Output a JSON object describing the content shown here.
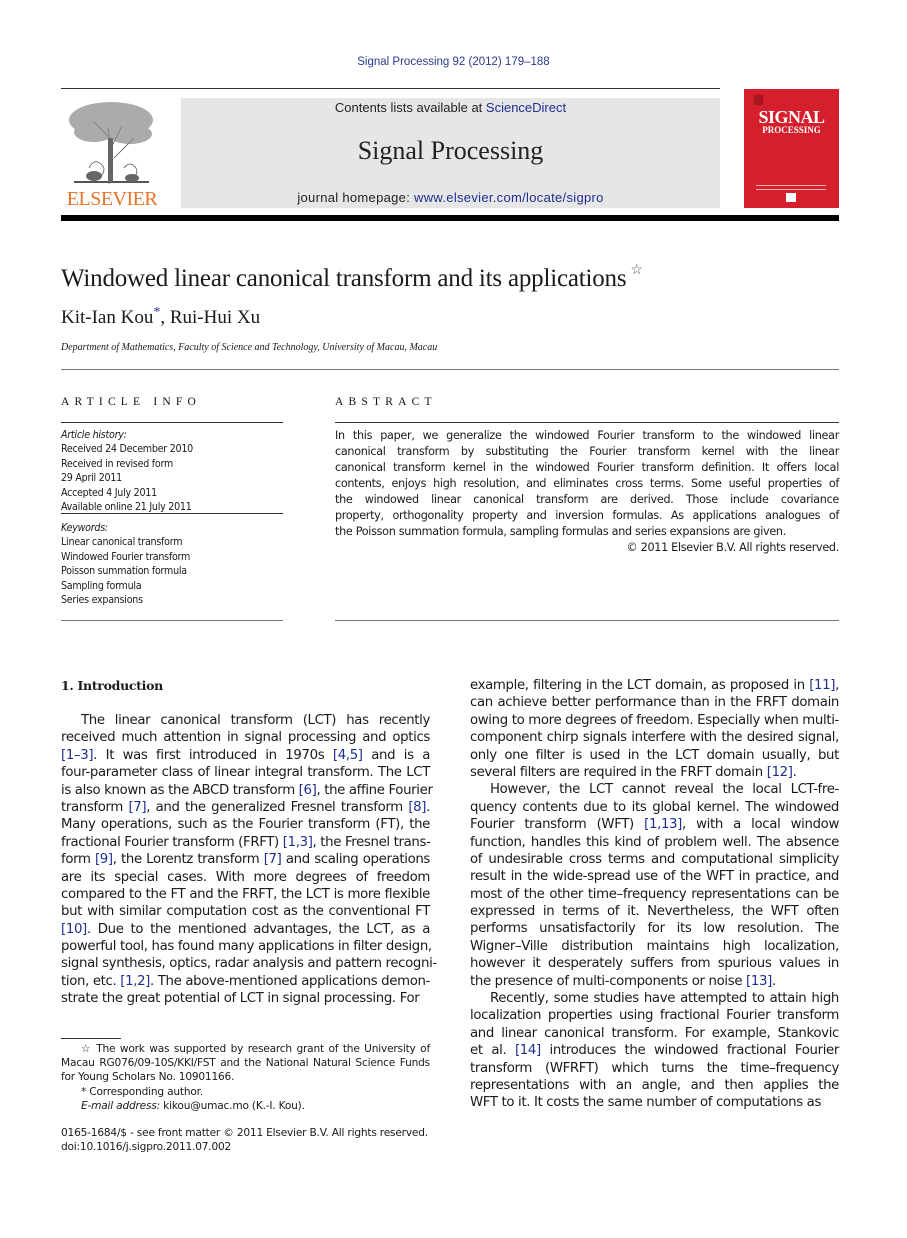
{
  "header": {
    "journal_ref": "Signal Processing 92 (2012) 179–188",
    "contents_prefix": "Contents lists available at ",
    "contents_link": "ScienceDirect",
    "journal_name": "Signal Processing",
    "homepage_prefix": "journal homepage: ",
    "homepage_link": "www.elsevier.com/locate/sigpro",
    "publisher_logo_text": "ELSEVIER",
    "cover_title_line1": "SIGNAL",
    "cover_title_line2": "PROCESSING",
    "colors": {
      "elsevier_orange": "#e8742a",
      "cover_red": "#d51f2c",
      "link_blue": "#1f2f8f",
      "header_gray": "#e6e6e6"
    }
  },
  "article": {
    "title": "Windowed linear canonical transform and its applications",
    "title_mark": "☆",
    "authors_part1": "Kit-Ian Kou",
    "author_mark": "*",
    "authors_part2": ", Rui-Hui Xu",
    "affiliation": "Department of Mathematics, Faculty of Science and Technology, University of Macau, Macau"
  },
  "article_info": {
    "heading": "ARTICLE INFO",
    "history_label": "Article history:",
    "history": [
      "Received 24 December 2010",
      "Received in revised form",
      "29 April 2011",
      "Accepted 4 July 2011",
      "Available online 21 July 2011"
    ],
    "keywords_label": "Keywords:",
    "keywords": [
      "Linear canonical transform",
      "Windowed Fourier transform",
      "Poisson summation formula",
      "Sampling formula",
      "Series expansions"
    ]
  },
  "abstract": {
    "heading": "ABSTRACT",
    "lines": [
      "In this paper, we generalize the windowed Fourier transform to the windowed linear",
      "canonical transform by substituting the Fourier transform kernel with the linear",
      "canonical transform kernel in the windowed Fourier transform definition. It offers local",
      "contents, enjoys high resolution, and eliminates cross terms. Some useful properties of",
      "the windowed linear canonical transform are derived. Those include covariance",
      "property, orthogonality property and inversion formulas. As applications analogues of",
      "the Poisson summation formula, sampling formulas and series expansions are given."
    ],
    "copyright": "© 2011 Elsevier B.V. All rights reserved."
  },
  "introduction": {
    "heading": "1.  Introduction",
    "col1_lines": [
      [
        {
          "t": "The linear canonical transform (LCT) has recently"
        }
      ],
      [
        {
          "t": "received much attention in signal processing and optics"
        }
      ],
      [
        {
          "t": "[1–3]",
          "ref": true
        },
        {
          "t": ". It was first introduced in 1970s "
        },
        {
          "t": "[4,5]",
          "ref": true
        },
        {
          "t": " and is a"
        }
      ],
      [
        {
          "t": "four-parameter class of linear integral transform. The LCT"
        }
      ],
      [
        {
          "t": "is also known as the ABCD transform "
        },
        {
          "t": "[6]",
          "ref": true
        },
        {
          "t": ", the affine Fourier"
        }
      ],
      [
        {
          "t": "transform "
        },
        {
          "t": "[7]",
          "ref": true
        },
        {
          "t": ", and the generalized Fresnel transform "
        },
        {
          "t": "[8]",
          "ref": true
        },
        {
          "t": "."
        }
      ],
      [
        {
          "t": "Many operations, such as the Fourier transform (FT), the"
        }
      ],
      [
        {
          "t": "fractional Fourier transform (FRFT) "
        },
        {
          "t": "[1,3]",
          "ref": true
        },
        {
          "t": ", the Fresnel trans-"
        }
      ],
      [
        {
          "t": "form "
        },
        {
          "t": "[9]",
          "ref": true
        },
        {
          "t": ", the Lorentz transform "
        },
        {
          "t": "[7]",
          "ref": true
        },
        {
          "t": " and scaling operations"
        }
      ],
      [
        {
          "t": "are its special cases. With more degrees of freedom"
        }
      ],
      [
        {
          "t": "compared to the FT and the FRFT, the LCT is more flexible"
        }
      ],
      [
        {
          "t": "but with similar computation cost as the conventional FT"
        }
      ],
      [
        {
          "t": "[10]",
          "ref": true
        },
        {
          "t": ". Due to the mentioned advantages, the LCT, as a"
        }
      ],
      [
        {
          "t": "powerful tool, has found many applications in filter design,"
        }
      ],
      [
        {
          "t": "signal synthesis, optics, radar analysis and pattern recogni-"
        }
      ],
      [
        {
          "t": "tion, etc. "
        },
        {
          "t": "[1,2]",
          "ref": true
        },
        {
          "t": ". The above-mentioned applications demon-"
        }
      ],
      [
        {
          "t": "strate the great potential of LCT in signal processing. For"
        }
      ]
    ],
    "col2_lines": [
      [
        {
          "t": "example, filtering in the LCT domain, as proposed in "
        },
        {
          "t": "[11]",
          "ref": true
        },
        {
          "t": ","
        }
      ],
      [
        {
          "t": "can achieve better performance than in the FRFT domain"
        }
      ],
      [
        {
          "t": "owing to more degrees of freedom. Especially when multi-"
        }
      ],
      [
        {
          "t": "component chirp signals interfere with the desired signal,"
        }
      ],
      [
        {
          "t": "only one filter is used in the LCT domain usually, but"
        }
      ],
      [
        {
          "t": "several filters are required in the FRFT domain "
        },
        {
          "t": "[12]",
          "ref": true
        },
        {
          "t": "."
        }
      ],
      [
        {
          "t": "However, the LCT cannot reveal the local LCT-fre-"
        }
      ],
      [
        {
          "t": "quency contents due to its global kernel. The windowed"
        }
      ],
      [
        {
          "t": "Fourier transform (WFT) "
        },
        {
          "t": "[1,13]",
          "ref": true
        },
        {
          "t": ", with a local window"
        }
      ],
      [
        {
          "t": "function, handles this kind of problem well. The absence"
        }
      ],
      [
        {
          "t": "of undesirable cross terms and computational simplicity"
        }
      ],
      [
        {
          "t": "result in the wide-spread use of the WFT in practice, and"
        }
      ],
      [
        {
          "t": "most of the other time–frequency representations can be"
        }
      ],
      [
        {
          "t": "expressed in terms of it. Nevertheless, the WFT often"
        }
      ],
      [
        {
          "t": "performs unsatisfactorily for its low resolution. The"
        }
      ],
      [
        {
          "t": "Wigner–Ville distribution maintains high localization,"
        }
      ],
      [
        {
          "t": "however it desperately suffers from spurious values in"
        }
      ],
      [
        {
          "t": "the presence of multi-components or noise "
        },
        {
          "t": "[13]",
          "ref": true
        },
        {
          "t": "."
        }
      ],
      [
        {
          "t": "Recently, some studies have attempted to attain high"
        }
      ],
      [
        {
          "t": "localization properties using fractional Fourier transform"
        }
      ],
      [
        {
          "t": "and linear canonical transform. For example, Stankovic"
        }
      ],
      [
        {
          "t": "et al. "
        },
        {
          "t": "[14]",
          "ref": true
        },
        {
          "t": " introduces the windowed fractional Fourier"
        }
      ],
      [
        {
          "t": "transform (WFRFT) which turns the time–frequency"
        }
      ],
      [
        {
          "t": "representations with an angle, and then applies the"
        }
      ],
      [
        {
          "t": "WFT to it. It costs the same number of computations as"
        }
      ]
    ]
  },
  "footnotes": {
    "funding_lines": [
      "☆ The work was supported by research grant of the University of",
      "Macau RG076/09-10S/KKI/FST and the National Natural Science Funds",
      "for Young Scholars No. 10901166."
    ],
    "corresponding": "* Corresponding author.",
    "email_label": "E-mail address:",
    "email_value": " kikou@umac.mo (K.-I. Kou).",
    "front_matter": "0165-1684/$ - see front matter © 2011 Elsevier B.V. All rights reserved.",
    "doi": "doi:10.1016/j.sigpro.2011.07.002"
  }
}
